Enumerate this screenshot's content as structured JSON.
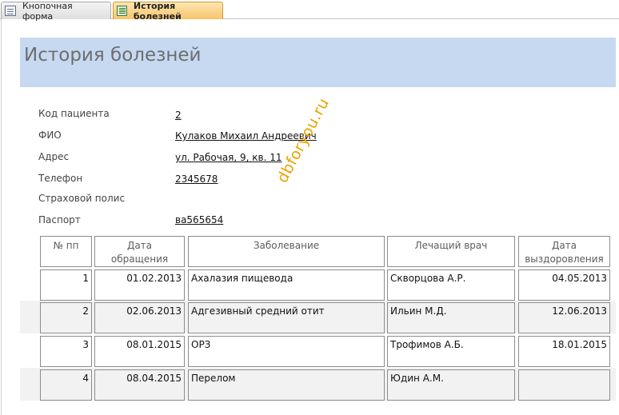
{
  "tabs": [
    {
      "label": "Кнопочная форма",
      "icon": "form-icon",
      "active": false
    },
    {
      "label": "История болезней",
      "icon": "report-icon",
      "active": true
    }
  ],
  "report": {
    "title": "История болезней"
  },
  "fields": [
    {
      "label": "Код пациента",
      "value": "2"
    },
    {
      "label": "ФИО",
      "value": "Кулаков Михаил Андреевич"
    },
    {
      "label": "Адрес",
      "value": "ул. Рабочая, 9, кв. 11"
    },
    {
      "label": "Телефон",
      "value": "2345678"
    },
    {
      "label": "Страховой полис",
      "value": ""
    },
    {
      "label": "Паспорт",
      "value": "ва565654"
    }
  ],
  "watermark": "dbforyou.ru",
  "table": {
    "headers": [
      "№ пп",
      "Дата обращения",
      "Заболевание",
      "Лечащий врач",
      "Дата выздоровления"
    ],
    "rows": [
      [
        "1",
        "01.02.2013",
        "Ахалазия пищевода",
        "Скворцова А.Р.",
        "04.05.2013"
      ],
      [
        "2",
        "02.06.2013",
        "Адгезивный средний отит",
        "Ильин М.Д.",
        "12.06.2013"
      ],
      [
        "3",
        "08.01.2015",
        "ОРЗ",
        "Трофимов А.Б.",
        "18.01.2015"
      ],
      [
        "4",
        "08.04.2015",
        "Перелом",
        "Юдин А.М.",
        ""
      ]
    ]
  },
  "colors": {
    "header_band": "#c6d9f1",
    "active_tab": "#f7c469",
    "watermark": "#e8a400",
    "alt_row": "#f2f2f2"
  }
}
